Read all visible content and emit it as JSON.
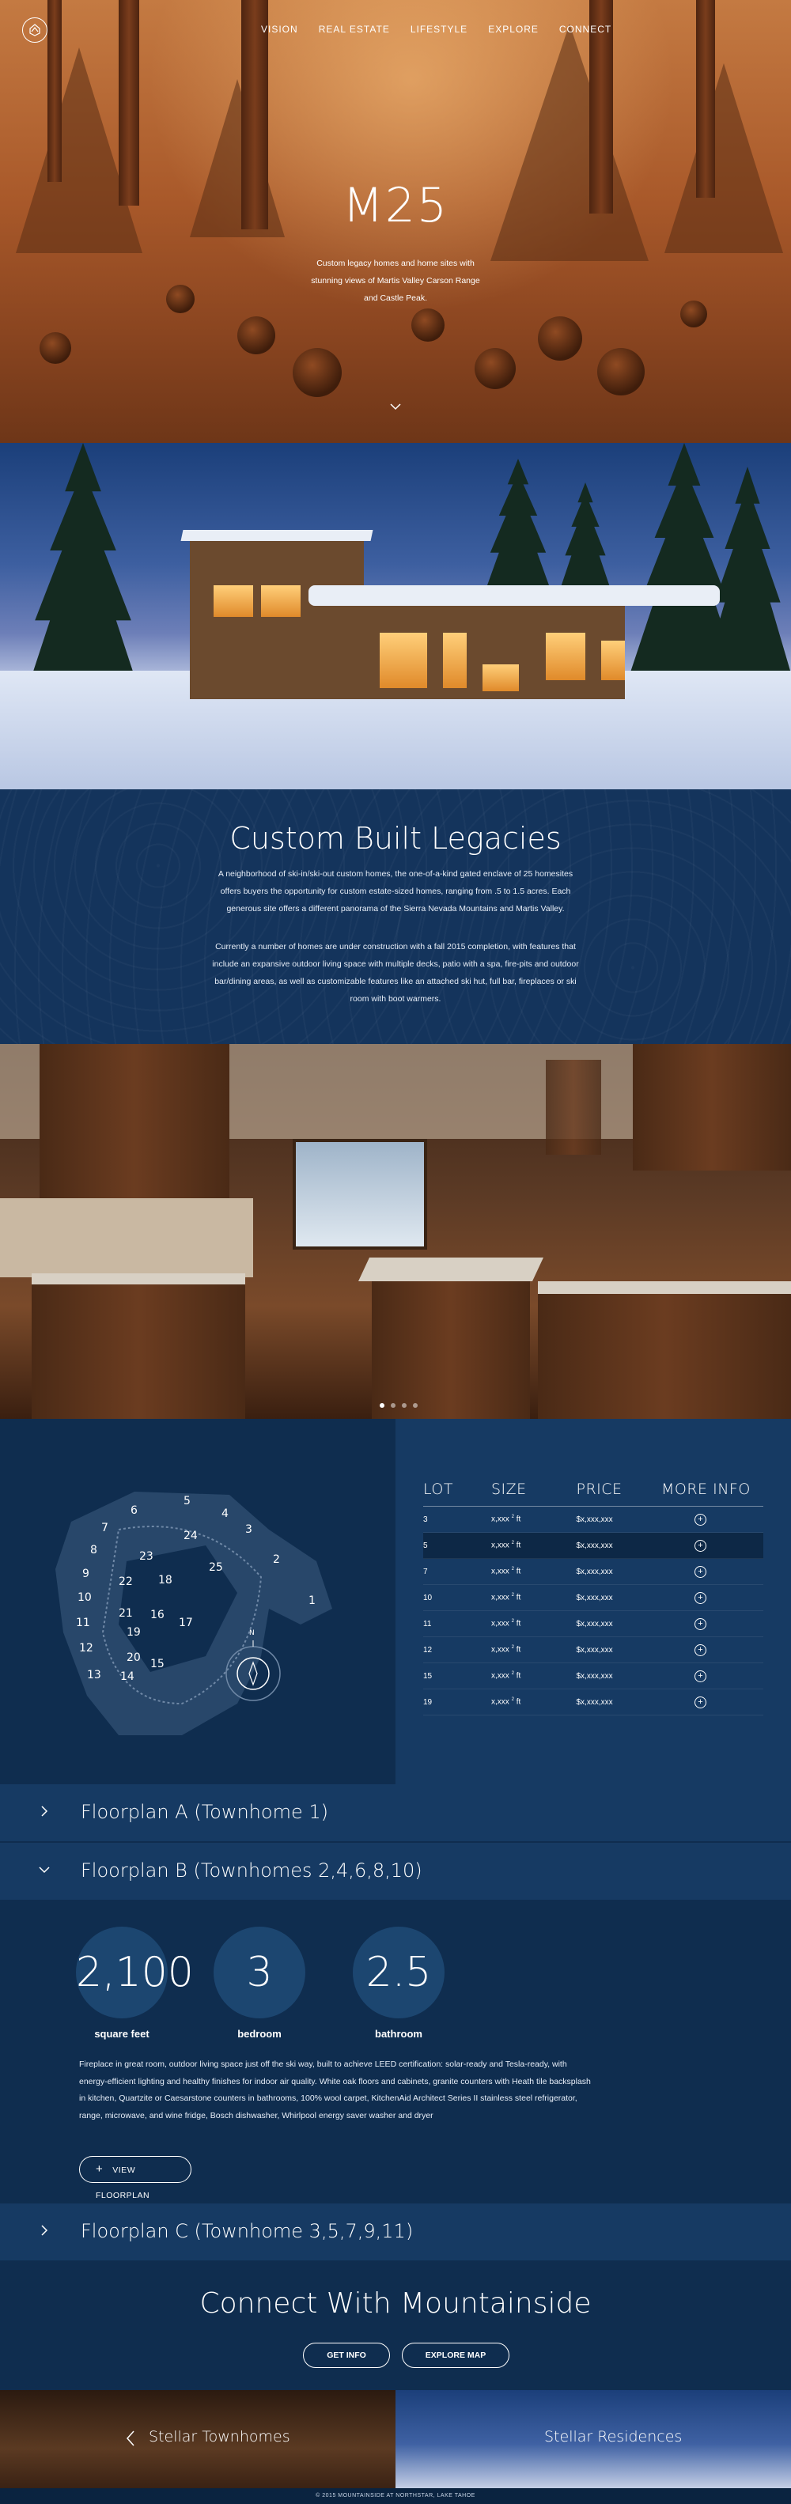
{
  "nav": {
    "items": [
      "VISION",
      "REAL ESTATE",
      "LIFESTYLE",
      "EXPLORE",
      "CONNECT"
    ]
  },
  "hero": {
    "title": "M25",
    "subtitle": "Custom legacy homes and home sites with stunning views of Martis Valley Carson Range and Castle Peak."
  },
  "legacy": {
    "title": "Custom Built Legacies",
    "p1": "A neighborhood of ski-in/ski-out custom homes, the one-of-a-kind gated enclave of 25 homesites offers buyers the opportunity for custom estate-sized homes, ranging from .5 to 1.5 acres. Each generous site offers a different panorama of the Sierra Nevada Mountains and Martis Valley.",
    "p2": "Currently a number of homes are under construction with a fall 2015 completion, with features that include an expansive outdoor living space with multiple decks, patio with a spa, fire-pits and outdoor bar/dining areas, as well as customizable features like an attached ski hut, full bar, fireplaces or ski room with boot warmers."
  },
  "map": {
    "lot_labels": [
      "1",
      "2",
      "3",
      "4",
      "5",
      "6",
      "7",
      "8",
      "9",
      "10",
      "11",
      "12",
      "13",
      "14",
      "15",
      "16",
      "17",
      "18",
      "19",
      "20",
      "21",
      "22",
      "23",
      "24",
      "25"
    ],
    "compass": "N"
  },
  "lots_table": {
    "headers": [
      "LOT",
      "SIZE",
      "PRICE",
      "MORE INFO"
    ],
    "rows": [
      {
        "lot": "3",
        "size": "x,xxx",
        "unit": "ft",
        "price": "$x,xxx,xxx"
      },
      {
        "lot": "5",
        "size": "x,xxx",
        "unit": "ft",
        "price": "$x,xxx,xxx"
      },
      {
        "lot": "7",
        "size": "x,xxx",
        "unit": "ft",
        "price": "$x,xxx,xxx"
      },
      {
        "lot": "10",
        "size": "x,xxx",
        "unit": "ft",
        "price": "$x,xxx,xxx"
      },
      {
        "lot": "11",
        "size": "x,xxx",
        "unit": "ft",
        "price": "$x,xxx,xxx"
      },
      {
        "lot": "12",
        "size": "x,xxx",
        "unit": "ft",
        "price": "$x,xxx,xxx"
      },
      {
        "lot": "15",
        "size": "x,xxx",
        "unit": "ft",
        "price": "$x,xxx,xxx"
      },
      {
        "lot": "19",
        "size": "x,xxx",
        "unit": "ft",
        "price": "$x,xxx,xxx"
      }
    ],
    "sq": "2",
    "info_glyph": "+"
  },
  "floorplans": {
    "a_label": "Floorplan A (Townhome 1)",
    "b_label": "Floorplan B (Townhomes 2,4,6,8,10)",
    "c_label": "Floorplan C (Townhome 3,5,7,9,11)",
    "stats": [
      {
        "value": "2,100",
        "label": "square feet"
      },
      {
        "value": "3",
        "label": "bedroom"
      },
      {
        "value": "2.5",
        "label": "bathroom"
      }
    ],
    "description": "Fireplace in great room, outdoor living space just off the ski way, built to achieve LEED certification: solar-ready and Tesla-ready, with energy-efficient lighting and healthy finishes for indoor air quality. White oak floors and cabinets, granite counters with Heath tile backsplash in kitchen, Quartzite or Caesarstone counters in bathrooms, 100% wool carpet, KitchenAid Architect Series II stainless steel refrigerator, range, microwave, and wine fridge, Bosch dishwasher, Whirlpool energy saver washer and dryer",
    "view_floorplan": "VIEW FLOORPLAN",
    "plus_glyph": "+"
  },
  "connect": {
    "title": "Connect With Mountainside",
    "get_info": "GET INFO",
    "explore_map": "EXPLORE MAP"
  },
  "panels": {
    "left": "Stellar Townhomes",
    "right": "Stellar Residences"
  },
  "footer": "© 2015 MOUNTAINSIDE AT NORTHSTAR, LAKE TAHOE",
  "colors": {
    "navy": "#0f2d4f",
    "navy_light": "#163a63",
    "hero_orange": "#a9592a"
  },
  "icons": [
    "mountain-logo-icon",
    "chevron-down-icon",
    "chevron-right-icon",
    "plus-circle-icon",
    "chevron-left-icon"
  ]
}
